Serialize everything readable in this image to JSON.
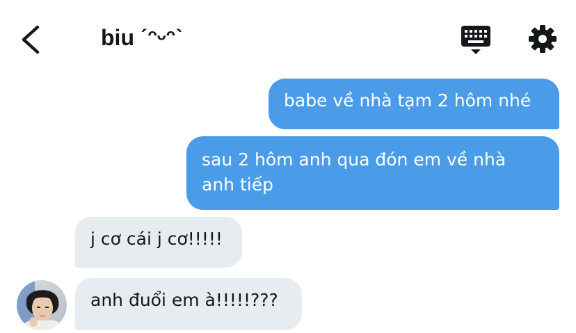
{
  "header": {
    "title": "biu ˊᵔᵕᵔˋ",
    "back_icon": "chevron-left-icon",
    "keyboard_icon": "keyboard-icon",
    "settings_icon": "gear-icon"
  },
  "messages": [
    {
      "direction": "outgoing",
      "text": "babe về nhà tạm 2 hôm nhé"
    },
    {
      "direction": "outgoing",
      "text": "sau 2 hôm anh qua đón em về nhà anh tiếp"
    },
    {
      "direction": "incoming",
      "text": "j cơ cái j cơ!!!!!"
    },
    {
      "direction": "incoming",
      "text": "anh đuổi em à!!!!!???"
    }
  ],
  "colors": {
    "outgoing_bubble": "#4a9be8",
    "incoming_bubble": "#e6ecf0",
    "text_dark": "#14171a",
    "accent": "#4a9be8"
  }
}
